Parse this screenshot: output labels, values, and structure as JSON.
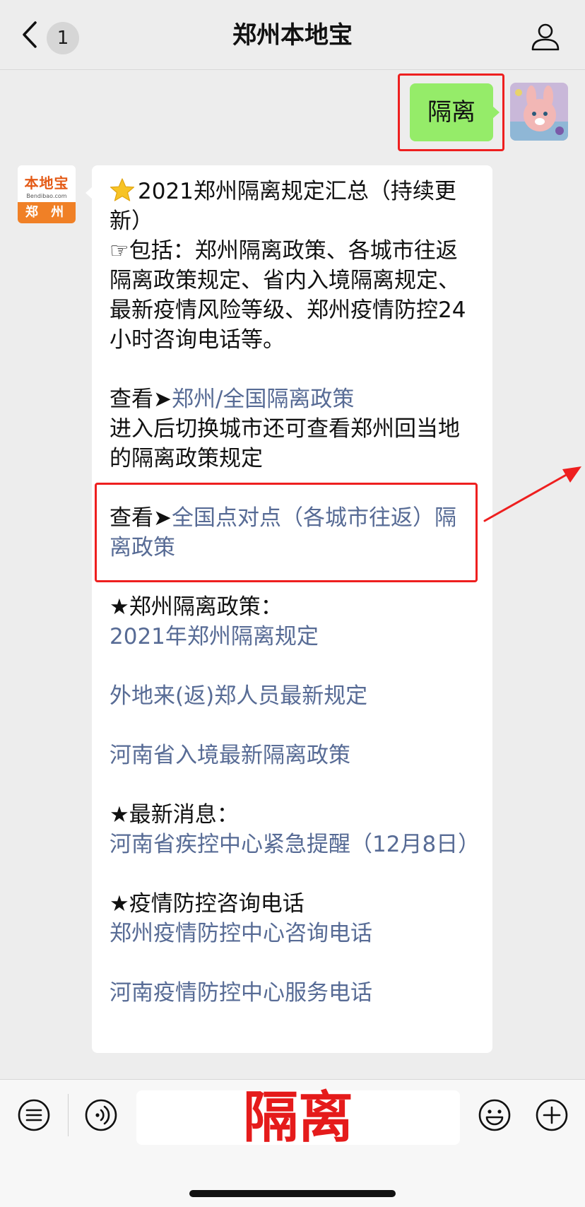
{
  "nav": {
    "title": "郑州本地宝",
    "unread_count": "1"
  },
  "outgoing": {
    "text": "隔离"
  },
  "brand_avatar": {
    "name": "本地宝",
    "sub": "Bendibao.com",
    "city": "郑 州"
  },
  "message": {
    "title": "2021郑州隔离规定汇总（持续更新）",
    "intro": "☞包括：郑州隔离政策、各城市往返隔离政策规定、省内入境隔离规定、最新疫情风险等级、郑州疫情防控24小时咨询电话等。",
    "view_prefix": "查看➤",
    "link1": "郑州/全国隔离政策",
    "link1_note": "进入后切换城市还可查看郑州回当地的隔离政策规定",
    "link2": "全国点对点（各城市往返）隔离政策",
    "section1_heading": "★郑州隔离政策：",
    "section1_links": [
      "2021年郑州隔离规定",
      "外地来(返)郑人员最新规定",
      "河南省入境最新隔离政策"
    ],
    "section2_heading": "★最新消息：",
    "section2_link": "河南省疾控中心紧急提醒（12月8日）",
    "section3_heading": "★疫情防控咨询电话",
    "section3_links": [
      "郑州疫情防控中心咨询电话",
      "河南疫情防控中心服务电话"
    ]
  },
  "input_bar": {
    "text": "隔离"
  },
  "colors": {
    "link": "#576b95",
    "bubble_out": "#95ec69",
    "highlight": "#ee1f1f",
    "background": "#ededed"
  },
  "icons": [
    "back-icon",
    "profile-icon",
    "menu-icon",
    "voice-icon",
    "emoji-icon",
    "plus-icon",
    "star-icon"
  ]
}
